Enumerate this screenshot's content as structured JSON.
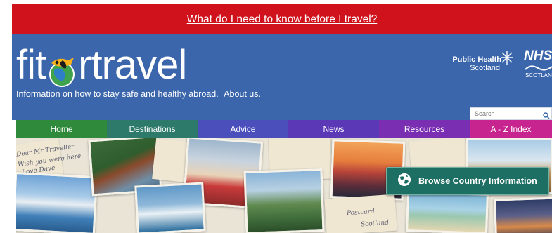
{
  "alert": {
    "link_text": "What do I need to know before I travel?"
  },
  "header": {
    "logo_text_before": "fit",
    "logo_text_after": "rtravel",
    "tagline": "Information on how to stay safe and healthy abroad.",
    "about_link": "About us.",
    "partner_logo_1": {
      "line1": "Public Health",
      "line2": "Scotland"
    },
    "partner_logo_2": {
      "line1": "NHS",
      "line2": "SCOTLAND"
    }
  },
  "search": {
    "placeholder": "Search"
  },
  "nav": {
    "items": [
      {
        "label": "Home",
        "color": "#2f8a3c"
      },
      {
        "label": "Destinations",
        "color": "#2d7a6b"
      },
      {
        "label": "Advice",
        "color": "#4b4fbc"
      },
      {
        "label": "News",
        "color": "#5b38b5"
      },
      {
        "label": "Resources",
        "color": "#7a2fb3"
      },
      {
        "label": "A - Z Index",
        "color": "#c8248f"
      }
    ]
  },
  "hero": {
    "browse_button": {
      "label": "Browse Country Information",
      "icon": "globe-icon"
    },
    "postcard_text": [
      "Dear Mr Traveller",
      "Wish you were here",
      "Love Dave",
      "Postcard",
      "Scotland"
    ]
  }
}
